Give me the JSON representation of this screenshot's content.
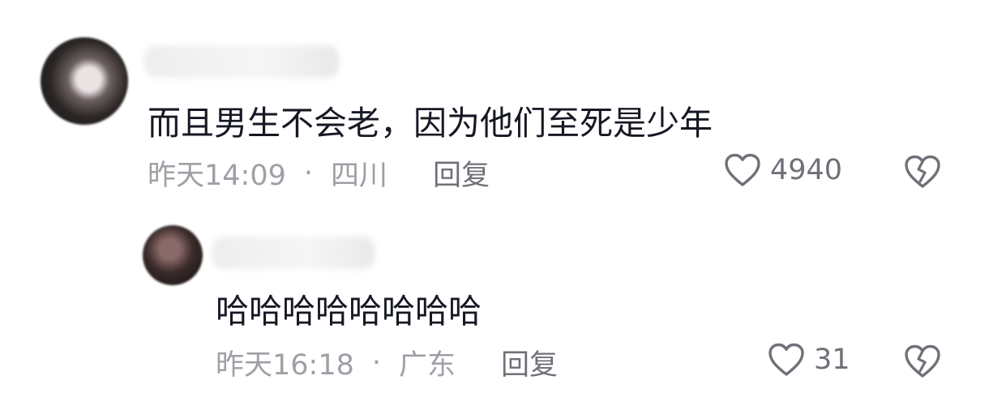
{
  "comments": [
    {
      "text": "而且男生不会老，因为他们至死是少年",
      "time": "昨天14:09",
      "location": "四川",
      "reply_label": "回复",
      "like_count": "4940"
    },
    {
      "text": "哈哈哈哈哈哈哈哈",
      "time": "昨天16:18",
      "location": "广东",
      "reply_label": "回复",
      "like_count": "31"
    }
  ],
  "separator": "·",
  "icons": {
    "like": "heart-outline-icon",
    "dislike": "broken-heart-icon"
  },
  "colors": {
    "text": "#161823",
    "meta": "#9ea0a6",
    "action": "#6f7178"
  }
}
